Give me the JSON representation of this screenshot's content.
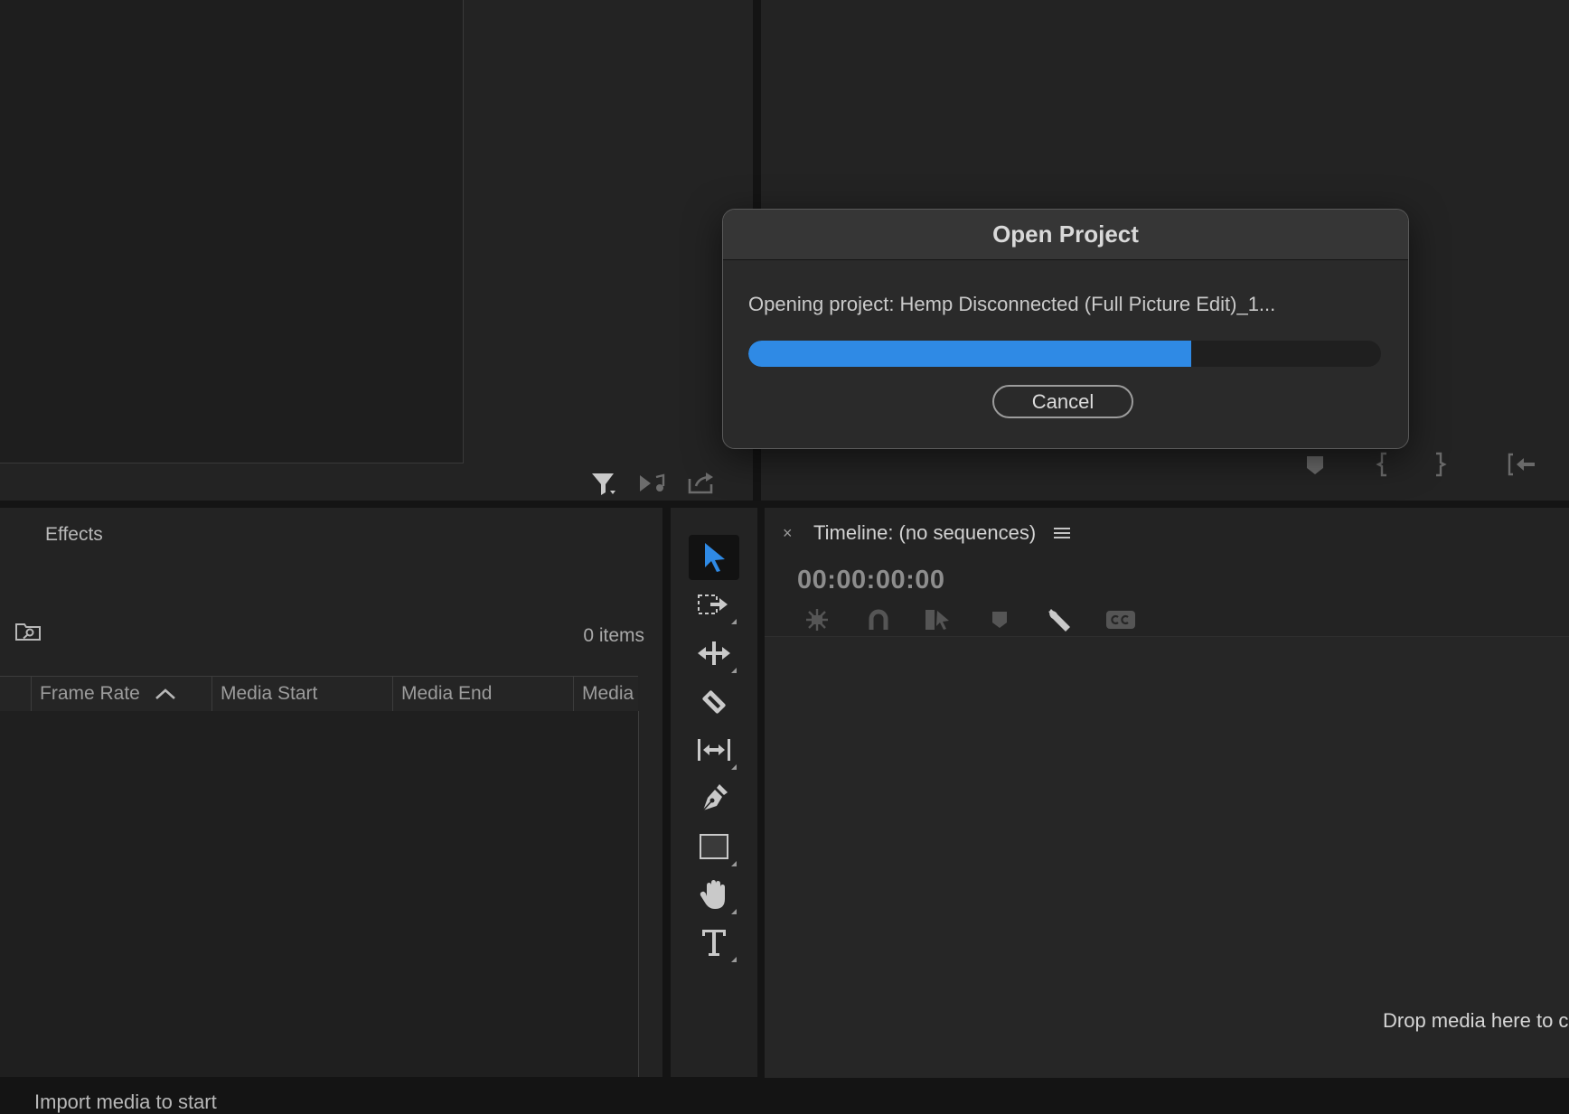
{
  "dialog": {
    "title": "Open Project",
    "message": "Opening project: Hemp Disconnected (Full Picture Edit)_1...",
    "progress_percent": 70,
    "cancel_label": "Cancel",
    "accent_color": "#2f8ae5"
  },
  "project_panel": {
    "tab_label": "Effects",
    "items_count": "0 items",
    "columns": [
      {
        "label": "Frame Rate",
        "sorted": "ascending"
      },
      {
        "label": "Media Start"
      },
      {
        "label": "Media End"
      },
      {
        "label": "Media"
      }
    ],
    "empty_hint": "Import media to start"
  },
  "source_monitor": {
    "icons": [
      "filter-icon",
      "insert-audio-icon",
      "export-frame-icon"
    ]
  },
  "program_monitor": {
    "icons": [
      "add-marker-icon",
      "mark-in-icon",
      "mark-out-icon",
      "go-to-in-icon"
    ]
  },
  "tools": [
    {
      "name": "selection-tool",
      "active": true
    },
    {
      "name": "track-select-forward-tool"
    },
    {
      "name": "ripple-edit-tool"
    },
    {
      "name": "razor-tool"
    },
    {
      "name": "slip-tool"
    },
    {
      "name": "pen-tool"
    },
    {
      "name": "rectangle-tool"
    },
    {
      "name": "hand-tool"
    },
    {
      "name": "type-tool"
    }
  ],
  "timeline": {
    "close_glyph": "×",
    "title": "Timeline: (no sequences)",
    "timecode": "00:00:00:00",
    "toolbar_icons": [
      "nest-icon",
      "snap-icon",
      "linked-selection-icon",
      "add-marker-icon",
      "settings-wrench-icon",
      "captions-icon"
    ],
    "drop_hint": "Drop media here to c"
  }
}
